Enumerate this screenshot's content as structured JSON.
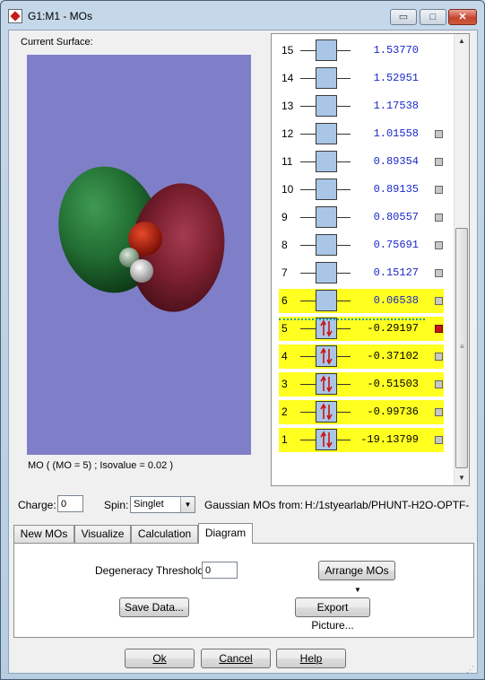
{
  "window": {
    "title": "G1:M1 - MOs",
    "controls": {
      "minimize": "▭",
      "maximize": "□",
      "close": "✕"
    }
  },
  "surface": {
    "label": "Current Surface:",
    "caption": "MO ( (MO = 5) ; Isovalue = 0.02 )"
  },
  "mo_list": {
    "rows": [
      {
        "num": "15",
        "energy": "1.53770",
        "occupancy": "virtual",
        "checkbox": false
      },
      {
        "num": "14",
        "energy": "1.52951",
        "occupancy": "virtual",
        "checkbox": false
      },
      {
        "num": "13",
        "energy": "1.17538",
        "occupancy": "virtual",
        "checkbox": false
      },
      {
        "num": "12",
        "energy": "1.01558",
        "occupancy": "virtual",
        "checkbox": true,
        "selected": false
      },
      {
        "num": "11",
        "energy": "0.89354",
        "occupancy": "virtual",
        "checkbox": true,
        "selected": false
      },
      {
        "num": "10",
        "energy": "0.89135",
        "occupancy": "virtual",
        "checkbox": true,
        "selected": false
      },
      {
        "num": "9",
        "energy": "0.80557",
        "occupancy": "virtual",
        "checkbox": true,
        "selected": false
      },
      {
        "num": "8",
        "energy": "0.75691",
        "occupancy": "virtual",
        "checkbox": true,
        "selected": false
      },
      {
        "num": "7",
        "energy": "0.15127",
        "occupancy": "virtual",
        "checkbox": true,
        "selected": false
      },
      {
        "num": "6",
        "energy": "0.06538",
        "occupancy": "lumo",
        "checkbox": true,
        "selected": false
      },
      {
        "num": "5",
        "energy": "-0.29197",
        "occupancy": "occupied",
        "checkbox": true,
        "selected": true
      },
      {
        "num": "4",
        "energy": "-0.37102",
        "occupancy": "occupied",
        "checkbox": true,
        "selected": false
      },
      {
        "num": "3",
        "energy": "-0.51503",
        "occupancy": "occupied",
        "checkbox": true,
        "selected": false
      },
      {
        "num": "2",
        "energy": "-0.99736",
        "occupancy": "occupied",
        "checkbox": true,
        "selected": false
      },
      {
        "num": "1",
        "energy": "-19.13799",
        "occupancy": "occupied",
        "checkbox": true,
        "selected": false
      }
    ]
  },
  "options": {
    "charge_label": "Charge:",
    "charge_value": "0",
    "spin_label": "Spin:",
    "spin_value": "Singlet",
    "source_label": "Gaussian MOs from:",
    "source_path": "H:/1styearlab/PHUNT-H2O-OPTF-"
  },
  "tabs": [
    "New MOs",
    "Visualize",
    "Calculation",
    "Diagram"
  ],
  "active_tab": "Diagram",
  "diagram": {
    "degeneracy_label": "Degeneracy Threshold:",
    "degeneracy_value": "0",
    "arrange_label": "Arrange MOs",
    "save_label": "Save Data...",
    "export_label": "Export Picture..."
  },
  "footer": {
    "ok_label": "Ok",
    "cancel_label": "Cancel",
    "help_label": "Help"
  },
  "colors": {
    "viewport_bg": "#7f7fc9",
    "occupied_highlight": "#ffff20",
    "orbital_box": "#a9c6e6",
    "energy_text_virtual": "#1a28c8",
    "energy_text_occupied": "#000000",
    "electron_arrow": "#d01010",
    "selected_checkbox": "#c81414",
    "lobe_positive": "#7a1f2e",
    "lobe_negative": "#1f6a2e"
  }
}
